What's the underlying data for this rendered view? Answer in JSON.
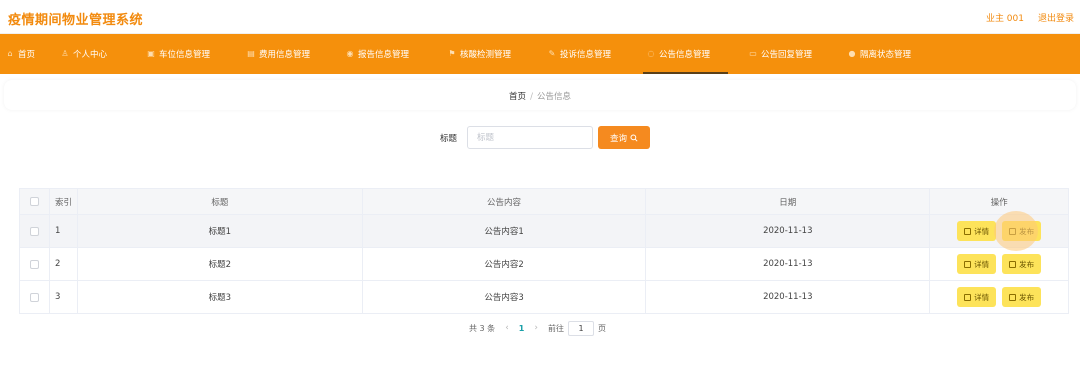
{
  "app": {
    "title": "疫情期间物业管理系统"
  },
  "user": {
    "name": "业主 001",
    "logout": "退出登录"
  },
  "nav": [
    {
      "label": "首页",
      "icon": "home-icon",
      "glyph": "⌂"
    },
    {
      "label": "个人中心",
      "icon": "user-icon",
      "glyph": "♙"
    },
    {
      "label": "车位信息管理",
      "icon": "car-icon",
      "glyph": "▣"
    },
    {
      "label": "费用信息管理",
      "icon": "money-icon",
      "glyph": "▤"
    },
    {
      "label": "报告信息管理",
      "icon": "location-icon",
      "glyph": "◉"
    },
    {
      "label": "核酸检测管理",
      "icon": "flag-icon",
      "glyph": "⚑"
    },
    {
      "label": "投诉信息管理",
      "icon": "message-icon",
      "glyph": "✎"
    },
    {
      "label": "公告信息管理",
      "icon": "notice-icon",
      "glyph": "◌"
    },
    {
      "label": "公告回复管理",
      "icon": "reply-icon",
      "glyph": "▭"
    },
    {
      "label": "隔离状态管理",
      "icon": "shield-icon",
      "glyph": "●"
    }
  ],
  "active_nav": "公告信息管理",
  "breadcrumb": {
    "home": "首页",
    "separator": "/",
    "current": "公告信息"
  },
  "search": {
    "label": "标题",
    "placeholder": "标题",
    "button": "查询"
  },
  "table": {
    "headers": {
      "index": "索引",
      "title": "标题",
      "content": "公告内容",
      "date": "日期",
      "ops": "操作"
    },
    "rows": [
      {
        "index": "1",
        "title": "标题1",
        "content": "公告内容1",
        "date": "2020-11-13"
      },
      {
        "index": "2",
        "title": "标题2",
        "content": "公告内容2",
        "date": "2020-11-13"
      },
      {
        "index": "3",
        "title": "标题3",
        "content": "公告内容3",
        "date": "2020-11-13"
      }
    ],
    "actions": {
      "detail": "详情",
      "publish": "发布"
    }
  },
  "pagination": {
    "total": "共 3 条",
    "prev": "‹",
    "page": "1",
    "next": "›",
    "goto": "前往",
    "goto_value": "1",
    "unit": "页"
  },
  "colors": {
    "brand": "#f5900c",
    "title": "#f28a0e",
    "action_button": "#fde35a",
    "page_active": "#1aa0a8"
  }
}
